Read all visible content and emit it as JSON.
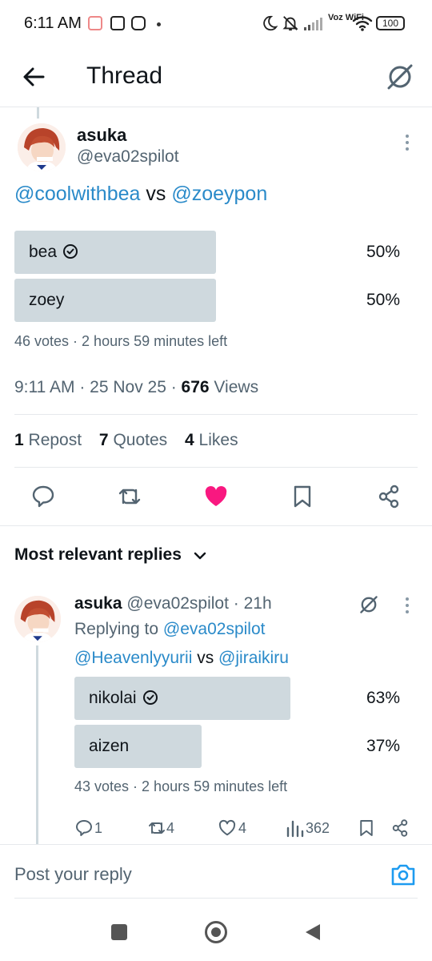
{
  "status_bar": {
    "time": "6:11 AM",
    "battery": "100",
    "network": "Voz WiFi"
  },
  "header": {
    "title": "Thread"
  },
  "main_post": {
    "name": "asuka",
    "handle": "@eva02spilot",
    "text_mention_1": "@coolwithbea",
    "text_vs": " vs ",
    "text_mention_2": "@zoeypon",
    "poll": [
      {
        "label": "bea",
        "pct": "50%",
        "fraction": 0.5,
        "winner": false
      },
      {
        "label": "zoey",
        "pct": "50%",
        "fraction": 0.5,
        "winner": false
      }
    ],
    "poll_votes": "46 votes",
    "poll_time_left": "2 hours 59 minutes left",
    "timestamp": "9:11 AM · 25 Nov 25 · ",
    "views_count": "676",
    "views_label": " Views",
    "reposts_count": "1",
    "reposts_label": "Repost",
    "quotes_count": "7",
    "quotes_label": "Quotes",
    "likes_count": "4",
    "likes_label": "Likes"
  },
  "replies_section": {
    "sort_label": "Most relevant replies"
  },
  "reply": {
    "name": "asuka",
    "handle": "@eva02spilot",
    "time": "· 21h",
    "replying_to_label": "Replying to ",
    "replying_to_handle": "@eva02spilot",
    "text_mention_1": "@Heavenlyyurii",
    "text_vs": " vs ",
    "text_mention_2": "@jiraikiru",
    "poll": [
      {
        "label": "nikolai",
        "pct": "63%",
        "fraction": 0.63
      },
      {
        "label": "aizen",
        "pct": "37%",
        "fraction": 0.37
      }
    ],
    "poll_votes": "43 votes",
    "poll_time_left": "2 hours 59 minutes left",
    "replies": "1",
    "reposts": "4",
    "likes": "4",
    "views": "362"
  },
  "composer": {
    "placeholder": "Post your reply"
  },
  "colors": {
    "link": "#2a8ac9",
    "like": "#f91880",
    "poll_bar": "#cfd9de",
    "muted": "#536471"
  }
}
